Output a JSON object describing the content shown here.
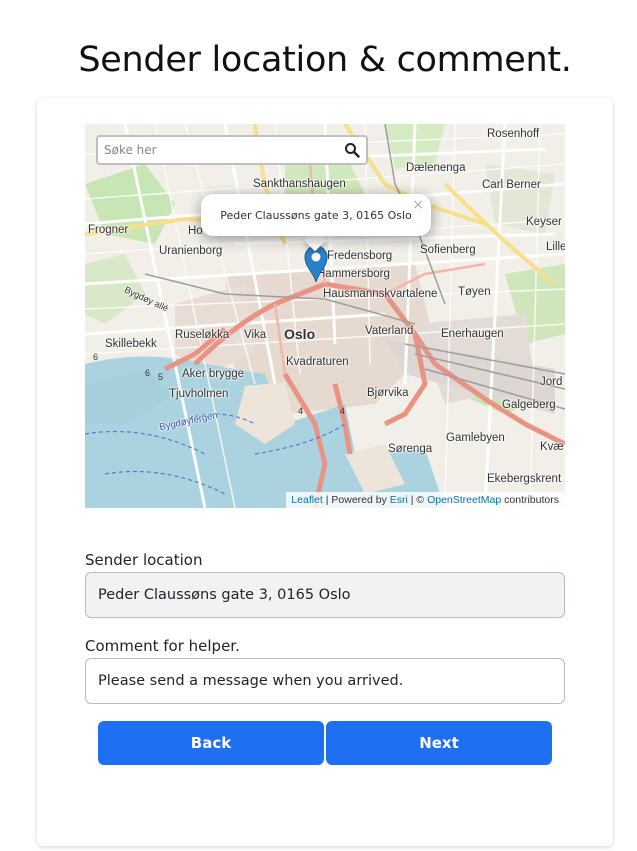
{
  "page": {
    "title": "Sender location & comment."
  },
  "map": {
    "search_placeholder": "Søke her",
    "popup_text": "Peder Claussøns gate 3, 0165 Oslo",
    "popup_close": "×",
    "attribution": {
      "leaflet": "Leaflet",
      "powered_by": " | Powered by ",
      "esri": "Esri",
      "sep": " | © ",
      "osm": "OpenStreetMap",
      "contributors": " contributors"
    },
    "labels": {
      "rosenhoff": "Rosenhoff",
      "daelenenga": "Dælenenga",
      "sankthanshaugen": "Sankthanshaugen",
      "carl_berner": "Carl Berner",
      "frogner": "Frogner",
      "uranienborg": "Uranienborg",
      "fredensborg": "Fredensborg",
      "sofienberg": "Sofienberg",
      "keyser": "Keyser",
      "hammersborg": "Hammersborg",
      "hausmannskvartalene": "Hausmannskvartalene",
      "toyen": "Tøyen",
      "ruseløkka": "Ruseløkka",
      "vika": "Vika",
      "oslo": "Oslo",
      "vaterland": "Vaterland",
      "enerhaugen": "Enerhaugen",
      "skillebekk": "Skillebekk",
      "kvadraturen": "Kvadraturen",
      "aker_brygge": "Aker brygge",
      "bjorvika": "Bjørvika",
      "tjuvholmen": "Tjuvholmen",
      "galgeberg": "Galgeberg",
      "gamlebyen": "Gamlebyen",
      "sorenga": "Sørenga",
      "ekebergskrent": "Ekebergskrent",
      "bygdoyfergen": "Bygdøyfergen",
      "bygdoy_alle": "Bygdøy allé",
      "ho": "Ho",
      "lille": "Lille",
      "jord": "Jord",
      "kvae": "Kvæ"
    }
  },
  "form": {
    "sender_location_label": "Sender location",
    "sender_location_value": "Peder Claussøns gate 3, 0165 Oslo",
    "comment_label": "Comment for helper.",
    "comment_value": "Please send a message when you arrived."
  },
  "buttons": {
    "back": "Back",
    "next": "Next"
  },
  "colors": {
    "primary": "#1e6ff2",
    "marker": "#2a81cb"
  },
  "icons": {
    "search": "search-icon",
    "marker": "map-marker-icon",
    "close": "close-icon"
  }
}
